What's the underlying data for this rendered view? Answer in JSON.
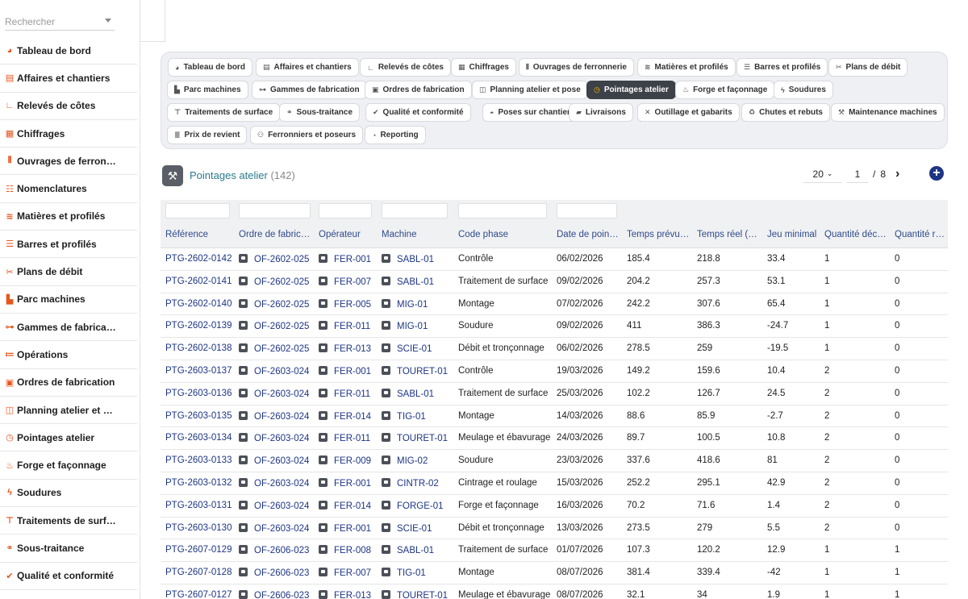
{
  "search": {
    "placeholder": "Rechercher"
  },
  "sidebar": {
    "items": [
      {
        "label": "Tableau de bord",
        "icon": "gauge-icon",
        "glyph": "◕"
      },
      {
        "label": "Affaires et chantiers",
        "icon": "briefcase-icon",
        "glyph": "▤"
      },
      {
        "label": "Relevés de côtes",
        "icon": "ruler-icon",
        "glyph": "∟"
      },
      {
        "label": "Chiffrages",
        "icon": "calculator-icon",
        "glyph": "▦"
      },
      {
        "label": "Ouvrages de ferronnerie",
        "icon": "gate-icon",
        "glyph": "⫴"
      },
      {
        "label": "Nomenclatures",
        "icon": "sitemap-icon",
        "glyph": "☷"
      },
      {
        "label": "Matières et profilés",
        "icon": "layers-icon",
        "glyph": "≋"
      },
      {
        "label": "Barres et profilés",
        "icon": "bars-icon",
        "glyph": "☰"
      },
      {
        "label": "Plans de débit",
        "icon": "scissors-icon",
        "glyph": "✂"
      },
      {
        "label": "Parc machines",
        "icon": "factory-icon",
        "glyph": "▙"
      },
      {
        "label": "Gammes de fabrication",
        "icon": "flow-icon",
        "glyph": "⊶"
      },
      {
        "label": "Opérations",
        "icon": "list-icon",
        "glyph": "≔"
      },
      {
        "label": "Ordres de fabrication",
        "icon": "clipboard-icon",
        "glyph": "▣"
      },
      {
        "label": "Planning atelier et pose",
        "icon": "calendar-icon",
        "glyph": "◫"
      },
      {
        "label": "Pointages atelier",
        "icon": "clock-icon",
        "glyph": "◷"
      },
      {
        "label": "Forge et façonnage",
        "icon": "flame-icon",
        "glyph": "♨"
      },
      {
        "label": "Soudures",
        "icon": "bolt-icon",
        "glyph": "ϟ"
      },
      {
        "label": "Traitements de surface",
        "icon": "paint-roller-icon",
        "glyph": "⊤"
      },
      {
        "label": "Sous-traitance",
        "icon": "handshake-icon",
        "glyph": "⚭"
      },
      {
        "label": "Qualité et conformité",
        "icon": "check-badge-icon",
        "glyph": "✔"
      }
    ]
  },
  "tabs": [
    {
      "label": "Tableau de bord",
      "icon": "gauge-icon",
      "glyph": "◕"
    },
    {
      "label": "Affaires et chantiers",
      "icon": "briefcase-icon",
      "glyph": "▤"
    },
    {
      "label": "Relevés de côtes",
      "icon": "ruler-icon",
      "glyph": "∟"
    },
    {
      "label": "Chiffrages",
      "icon": "calculator-icon",
      "glyph": "▦"
    },
    {
      "label": "Ouvrages de ferronnerie",
      "icon": "gate-icon",
      "glyph": "⫴"
    },
    {
      "label": "Matières et profilés",
      "icon": "layers-icon",
      "glyph": "≋"
    },
    {
      "label": "Barres et profilés",
      "icon": "bars-icon",
      "glyph": "☰"
    },
    {
      "label": "Plans de débit",
      "icon": "scissors-icon",
      "glyph": "✂"
    },
    {
      "label": "Parc machines",
      "icon": "factory-icon",
      "glyph": "▙"
    },
    {
      "label": "Gammes de fabrication",
      "icon": "flow-icon",
      "glyph": "⊶"
    },
    {
      "label": "Ordres de fabrication",
      "icon": "clipboard-icon",
      "glyph": "▣"
    },
    {
      "label": "Planning atelier et pose",
      "icon": "calendar-icon",
      "glyph": "◫"
    },
    {
      "label": "Pointages atelier",
      "icon": "clock-icon",
      "glyph": "◷",
      "active": true
    },
    {
      "label": "Forge et façonnage",
      "icon": "flame-icon",
      "glyph": "♨"
    },
    {
      "label": "Soudures",
      "icon": "bolt-icon",
      "glyph": "ϟ"
    },
    {
      "label": "Traitements de surface",
      "icon": "paint-roller-icon",
      "glyph": "⊤"
    },
    {
      "label": "Sous-traitance",
      "icon": "handshake-icon",
      "glyph": "⚭"
    },
    {
      "label": "Qualité et conformité",
      "icon": "check-badge-icon",
      "glyph": "✔"
    },
    {
      "label": "Poses sur chantier",
      "icon": "helmet-icon",
      "glyph": "◓"
    },
    {
      "label": "Livraisons",
      "icon": "truck-icon",
      "glyph": "▰"
    },
    {
      "label": "Outillage et gabarits",
      "icon": "tools-icon",
      "glyph": "✕"
    },
    {
      "label": "Chutes et rebuts",
      "icon": "recycle-icon",
      "glyph": "♻"
    },
    {
      "label": "Maintenance machines",
      "icon": "wrench-icon",
      "glyph": "⚒"
    },
    {
      "label": "Prix de revient",
      "icon": "coins-icon",
      "glyph": "≣"
    },
    {
      "label": "Ferronniers et poseurs",
      "icon": "users-icon",
      "glyph": "⚇"
    },
    {
      "label": "Reporting",
      "icon": "pie-chart-icon",
      "glyph": "◔"
    }
  ],
  "page": {
    "title": "Pointages atelier",
    "count": "(142)",
    "icon": "anvil-icon",
    "per_page": "20",
    "current_page": "1",
    "page_sep": "/",
    "total_pages": "8",
    "next_glyph": "›",
    "add_glyph": "+"
  },
  "columns": [
    "Référence",
    "Ordre de fabric…",
    "Opérateur",
    "Machine",
    "Code phase",
    "Date de poin…",
    "Temps prévu…",
    "Temps réel (…",
    "Jeu minimal",
    "Quantité déc…",
    "Quantité reb…"
  ],
  "rows": [
    [
      "PTG-2602-0142",
      "OF-2602-025",
      "FER-001",
      "SABL-01",
      "Contrôle",
      "06/02/2026",
      "185.4",
      "218.8",
      "33.4",
      "1",
      "0"
    ],
    [
      "PTG-2602-0141",
      "OF-2602-025",
      "FER-007",
      "SABL-01",
      "Traitement de surface",
      "09/02/2026",
      "204.2",
      "257.3",
      "53.1",
      "1",
      "0"
    ],
    [
      "PTG-2602-0140",
      "OF-2602-025",
      "FER-005",
      "MIG-01",
      "Montage",
      "07/02/2026",
      "242.2",
      "307.6",
      "65.4",
      "1",
      "0"
    ],
    [
      "PTG-2602-0139",
      "OF-2602-025",
      "FER-011",
      "MIG-01",
      "Soudure",
      "09/02/2026",
      "411",
      "386.3",
      "-24.7",
      "1",
      "0"
    ],
    [
      "PTG-2602-0138",
      "OF-2602-025",
      "FER-013",
      "SCIE-01",
      "Débit et tronçonnage",
      "06/02/2026",
      "278.5",
      "259",
      "-19.5",
      "1",
      "0"
    ],
    [
      "PTG-2603-0137",
      "OF-2603-024",
      "FER-001",
      "TOURET-01",
      "Contrôle",
      "19/03/2026",
      "149.2",
      "159.6",
      "10.4",
      "2",
      "0"
    ],
    [
      "PTG-2603-0136",
      "OF-2603-024",
      "FER-011",
      "SABL-01",
      "Traitement de surface",
      "25/03/2026",
      "102.2",
      "126.7",
      "24.5",
      "2",
      "0"
    ],
    [
      "PTG-2603-0135",
      "OF-2603-024",
      "FER-014",
      "TIG-01",
      "Montage",
      "14/03/2026",
      "88.6",
      "85.9",
      "-2.7",
      "2",
      "0"
    ],
    [
      "PTG-2603-0134",
      "OF-2603-024",
      "FER-011",
      "TOURET-01",
      "Meulage et ébavurage",
      "24/03/2026",
      "89.7",
      "100.5",
      "10.8",
      "2",
      "0"
    ],
    [
      "PTG-2603-0133",
      "OF-2603-024",
      "FER-009",
      "MIG-02",
      "Soudure",
      "23/03/2026",
      "337.6",
      "418.6",
      "81",
      "2",
      "0"
    ],
    [
      "PTG-2603-0132",
      "OF-2603-024",
      "FER-001",
      "CINTR-02",
      "Cintrage et roulage",
      "15/03/2026",
      "252.2",
      "295.1",
      "42.9",
      "2",
      "0"
    ],
    [
      "PTG-2603-0131",
      "OF-2603-024",
      "FER-014",
      "FORGE-01",
      "Forge et façonnage",
      "16/03/2026",
      "70.2",
      "71.6",
      "1.4",
      "2",
      "0"
    ],
    [
      "PTG-2603-0130",
      "OF-2603-024",
      "FER-001",
      "SCIE-01",
      "Débit et tronçonnage",
      "13/03/2026",
      "273.5",
      "279",
      "5.5",
      "2",
      "0"
    ],
    [
      "PTG-2607-0129",
      "OF-2606-023",
      "FER-008",
      "SABL-01",
      "Traitement de surface",
      "01/07/2026",
      "107.3",
      "120.2",
      "12.9",
      "1",
      "1"
    ],
    [
      "PTG-2607-0128",
      "OF-2606-023",
      "FER-007",
      "TIG-01",
      "Montage",
      "08/07/2026",
      "381.4",
      "339.4",
      "-42",
      "1",
      "1"
    ],
    [
      "PTG-2607-0127",
      "OF-2606-023",
      "FER-013",
      "TOURET-01",
      "Meulage et ébavurage",
      "08/07/2026",
      "32.1",
      "34",
      "1.9",
      "1",
      "1"
    ]
  ]
}
